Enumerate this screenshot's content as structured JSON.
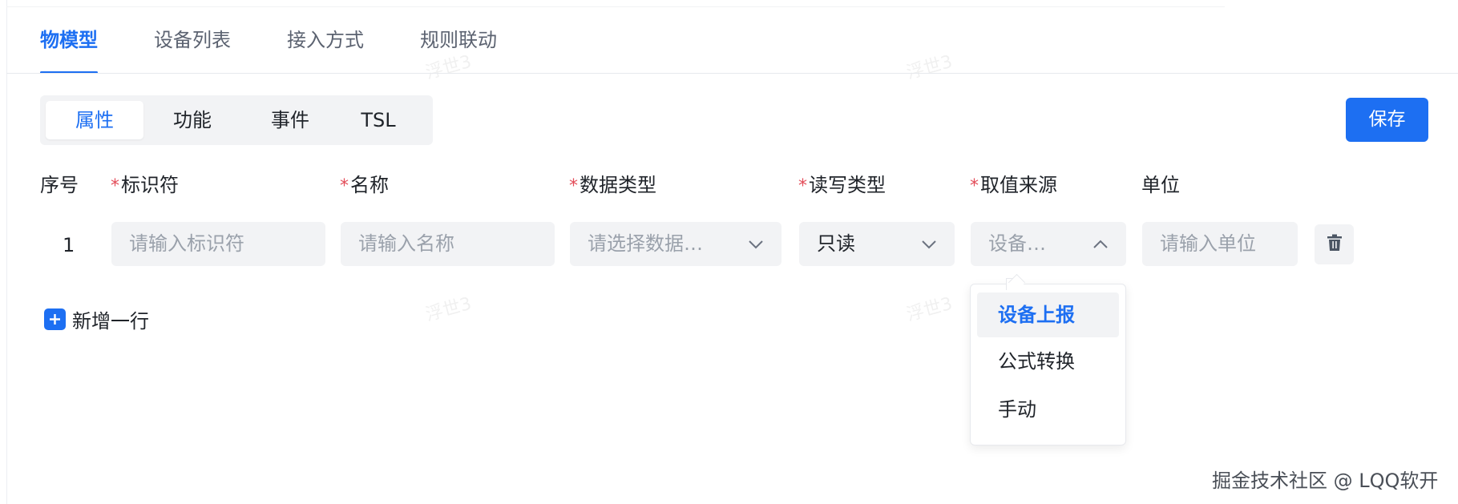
{
  "top_tabs": [
    "物模型",
    "设备列表",
    "接入方式",
    "规则联动"
  ],
  "segment_tabs": [
    "属性",
    "功能",
    "事件",
    "TSL"
  ],
  "save_label": "保存",
  "columns": {
    "index": "序号",
    "identifier": "标识符",
    "name": "名称",
    "data_type": "数据类型",
    "rw_type": "读写类型",
    "value_source": "取值来源",
    "unit": "单位",
    "required_mark": "*"
  },
  "row": {
    "index": "1",
    "identifier_placeholder": "请输入标识符",
    "name_placeholder": "请输入名称",
    "data_type_placeholder": "请选择数据…",
    "rw_type_value": "只读",
    "value_source_placeholder": "设备…",
    "unit_placeholder": "请输入单位"
  },
  "add_row_label": "新增一行",
  "dropdown_options": [
    "设备上报",
    "公式转换",
    "手动"
  ],
  "dropdown_selected": "设备上报",
  "watermark_text": "浮世3",
  "footer_watermark": "掘金技术社区 @ LQQ软开",
  "colors": {
    "accent": "#1d6ff2",
    "required": "#e34d59",
    "field_bg": "#f2f3f5"
  },
  "icons": {
    "chevron": "chevron-down-icon",
    "chevron_up": "chevron-up-icon",
    "delete": "trash-icon",
    "add": "plus-icon"
  }
}
